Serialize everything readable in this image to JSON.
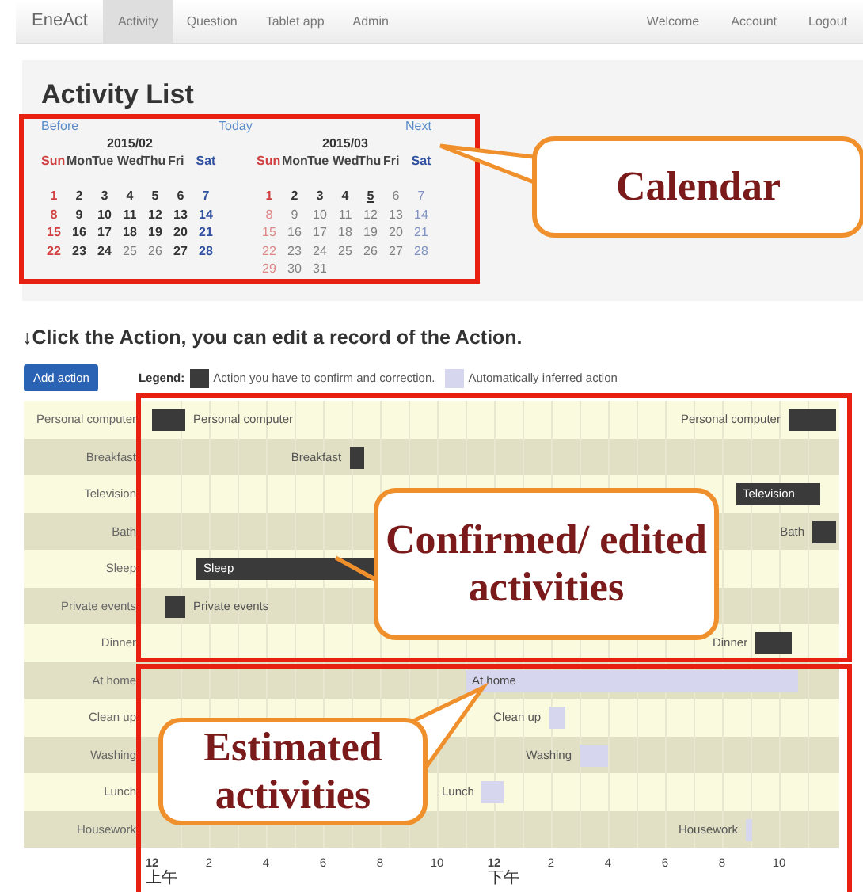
{
  "nav": {
    "brand": "EneAct",
    "items": [
      {
        "label": "Activity",
        "selected": true
      },
      {
        "label": "Question",
        "selected": false
      },
      {
        "label": "Tablet app",
        "selected": false
      },
      {
        "label": "Admin",
        "selected": false
      }
    ],
    "right_items": [
      "Welcome",
      "Account",
      "Logout"
    ]
  },
  "title": "Activity List",
  "calendar": {
    "before": "Before",
    "today": "Today",
    "next": "Next",
    "months": [
      {
        "title": "2015/02",
        "weekdays": [
          "Sun",
          "Mon",
          "Tue",
          "Wed",
          "Thu",
          "Fri",
          "Sat"
        ],
        "weeks": [
          [
            {
              "day": "1",
              "dim": false,
              "today": false
            },
            {
              "day": "2",
              "dim": false,
              "today": false
            },
            {
              "day": "3",
              "dim": false,
              "today": false
            },
            {
              "day": "4",
              "dim": false,
              "today": false
            },
            {
              "day": "5",
              "dim": false,
              "today": false
            },
            {
              "day": "6",
              "dim": false,
              "today": false
            },
            {
              "day": "7",
              "dim": false,
              "today": false
            }
          ],
          [
            {
              "day": "8",
              "dim": false,
              "today": false
            },
            {
              "day": "9",
              "dim": false,
              "today": false
            },
            {
              "day": "10",
              "dim": false,
              "today": false
            },
            {
              "day": "11",
              "dim": false,
              "today": false
            },
            {
              "day": "12",
              "dim": false,
              "today": false
            },
            {
              "day": "13",
              "dim": false,
              "today": false
            },
            {
              "day": "14",
              "dim": false,
              "today": false
            }
          ],
          [
            {
              "day": "15",
              "dim": false,
              "today": false
            },
            {
              "day": "16",
              "dim": false,
              "today": false
            },
            {
              "day": "17",
              "dim": false,
              "today": false
            },
            {
              "day": "18",
              "dim": false,
              "today": false
            },
            {
              "day": "19",
              "dim": false,
              "today": false
            },
            {
              "day": "20",
              "dim": false,
              "today": false
            },
            {
              "day": "21",
              "dim": false,
              "today": false
            }
          ],
          [
            {
              "day": "22",
              "dim": false,
              "today": false
            },
            {
              "day": "23",
              "dim": false,
              "today": false
            },
            {
              "day": "24",
              "dim": false,
              "today": false
            },
            {
              "day": "25",
              "dim": true,
              "today": false
            },
            {
              "day": "26",
              "dim": true,
              "today": false
            },
            {
              "day": "27",
              "dim": false,
              "today": false
            },
            {
              "day": "28",
              "dim": false,
              "today": false
            }
          ]
        ]
      },
      {
        "title": "2015/03",
        "weekdays": [
          "Sun",
          "Mon",
          "Tue",
          "Wed",
          "Thu",
          "Fri",
          "Sat"
        ],
        "weeks": [
          [
            {
              "day": "1",
              "dim": false,
              "today": false
            },
            {
              "day": "2",
              "dim": false,
              "today": false
            },
            {
              "day": "3",
              "dim": false,
              "today": false
            },
            {
              "day": "4",
              "dim": false,
              "today": false
            },
            {
              "day": "5",
              "dim": false,
              "today": true
            },
            {
              "day": "6",
              "dim": true,
              "today": false
            },
            {
              "day": "7",
              "dim": true,
              "today": false
            }
          ],
          [
            {
              "day": "8",
              "dim": true,
              "today": false
            },
            {
              "day": "9",
              "dim": true,
              "today": false
            },
            {
              "day": "10",
              "dim": true,
              "today": false
            },
            {
              "day": "11",
              "dim": true,
              "today": false
            },
            {
              "day": "12",
              "dim": true,
              "today": false
            },
            {
              "day": "13",
              "dim": true,
              "today": false
            },
            {
              "day": "14",
              "dim": true,
              "today": false
            }
          ],
          [
            {
              "day": "15",
              "dim": true,
              "today": false
            },
            {
              "day": "16",
              "dim": true,
              "today": false
            },
            {
              "day": "17",
              "dim": true,
              "today": false
            },
            {
              "day": "18",
              "dim": true,
              "today": false
            },
            {
              "day": "19",
              "dim": true,
              "today": false
            },
            {
              "day": "20",
              "dim": true,
              "today": false
            },
            {
              "day": "21",
              "dim": true,
              "today": false
            }
          ],
          [
            {
              "day": "22",
              "dim": true,
              "today": false
            },
            {
              "day": "23",
              "dim": true,
              "today": false
            },
            {
              "day": "24",
              "dim": true,
              "today": false
            },
            {
              "day": "25",
              "dim": true,
              "today": false
            },
            {
              "day": "26",
              "dim": true,
              "today": false
            },
            {
              "day": "27",
              "dim": true,
              "today": false
            },
            {
              "day": "28",
              "dim": true,
              "today": false
            }
          ],
          [
            {
              "day": "29",
              "dim": true,
              "today": false
            },
            {
              "day": "30",
              "dim": true,
              "today": false
            },
            {
              "day": "31",
              "dim": true,
              "today": false
            }
          ]
        ]
      }
    ]
  },
  "instruction": "↓Click the Action, you can edit a record of the Action.",
  "add_button": "Add action",
  "legend": {
    "title": "Legend:",
    "items": [
      {
        "kind": "confirmed",
        "label": "Action you have to confirm and correction."
      },
      {
        "kind": "estimated",
        "label": "Automatically inferred action"
      }
    ]
  },
  "rows": [
    {
      "label": "Personal computer",
      "bars": [
        {
          "kind": "confirmed",
          "label": "Personal computer"
        },
        {
          "kind": "confirmed",
          "label": "Personal computer"
        }
      ]
    },
    {
      "label": "Breakfast",
      "bars": [
        {
          "kind": "confirmed",
          "label": "Breakfast"
        }
      ]
    },
    {
      "label": "Television",
      "bars": [
        {
          "kind": "confirmed",
          "label": "Television"
        }
      ]
    },
    {
      "label": "Bath",
      "bars": [
        {
          "kind": "confirmed",
          "label": "Bath"
        }
      ]
    },
    {
      "label": "Sleep",
      "bars": [
        {
          "kind": "confirmed",
          "label": "Sleep"
        }
      ]
    },
    {
      "label": "Private events",
      "bars": [
        {
          "kind": "confirmed",
          "label": "Private events"
        }
      ]
    },
    {
      "label": "Dinner",
      "bars": [
        {
          "kind": "confirmed",
          "label": "Dinner"
        }
      ]
    },
    {
      "label": "At home",
      "bars": [
        {
          "kind": "estimated",
          "label": "At home"
        }
      ]
    },
    {
      "label": "Clean up",
      "bars": [
        {
          "kind": "estimated",
          "label": "Clean up"
        }
      ]
    },
    {
      "label": "Washing",
      "bars": [
        {
          "kind": "estimated",
          "label": "Washing"
        }
      ]
    },
    {
      "label": "Lunch",
      "bars": [
        {
          "kind": "estimated",
          "label": "Lunch"
        }
      ]
    },
    {
      "label": "Housework",
      "bars": [
        {
          "kind": "estimated",
          "label": "Housework"
        }
      ]
    }
  ],
  "time_axis": [
    {
      "label": "12",
      "bold": true,
      "sub": "上午"
    },
    {
      "label": "2",
      "bold": false
    },
    {
      "label": "4",
      "bold": false
    },
    {
      "label": "6",
      "bold": false
    },
    {
      "label": "8",
      "bold": false
    },
    {
      "label": "10",
      "bold": false
    },
    {
      "label": "12",
      "bold": true,
      "sub": "下午"
    },
    {
      "label": "2",
      "bold": false
    },
    {
      "label": "4",
      "bold": false
    },
    {
      "label": "6",
      "bold": false
    },
    {
      "label": "8",
      "bold": false
    },
    {
      "label": "10",
      "bold": false
    }
  ],
  "callouts": [
    {
      "text": "Calendar"
    },
    {
      "text": "Confirmed/ edited activities"
    },
    {
      "text": "Estimated activities"
    }
  ]
}
